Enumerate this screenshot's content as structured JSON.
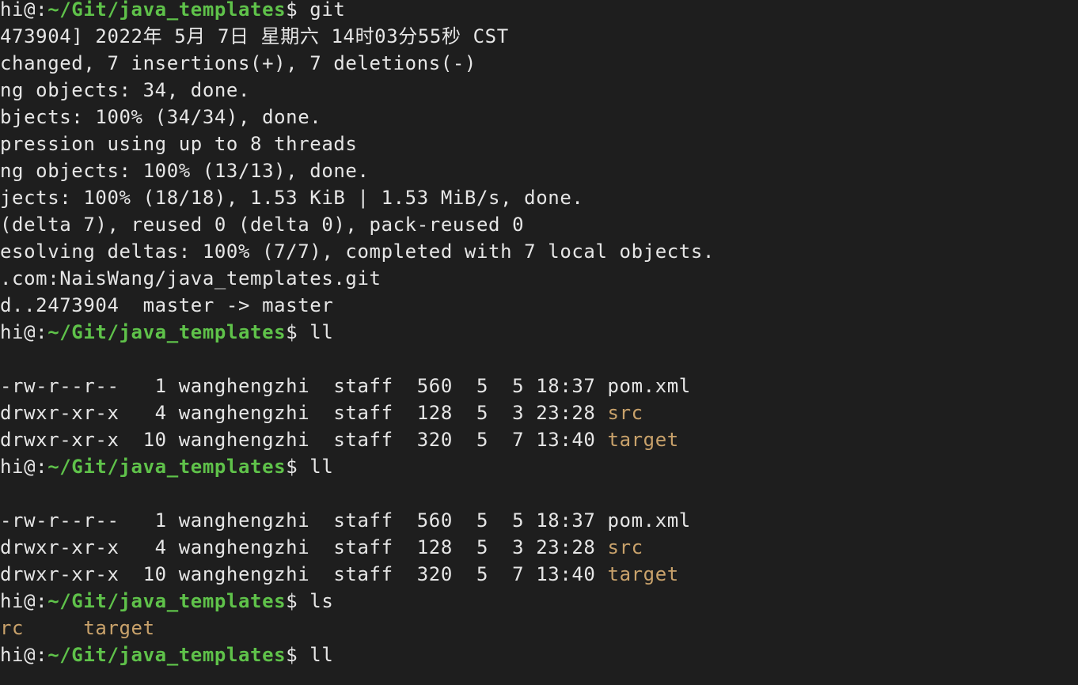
{
  "colors": {
    "background": "#1e1e1e",
    "text": "#e6e6e6",
    "prompt_path": "#5fc24a",
    "directory": "#c9a26b"
  },
  "lines": [
    {
      "parts": [
        {
          "text": "hi@:",
          "style": "plain"
        },
        {
          "text": "~/Git/java_templates",
          "style": "path"
        },
        {
          "text": "$ git",
          "style": "plain"
        }
      ]
    },
    {
      "parts": [
        {
          "text": "473904] 2022年 5月 7日 星期六 14时03分55秒 CST",
          "style": "plain"
        }
      ]
    },
    {
      "parts": [
        {
          "text": "changed, 7 insertions(+), 7 deletions(-)",
          "style": "plain"
        }
      ]
    },
    {
      "parts": [
        {
          "text": "ng objects: 34, done.",
          "style": "plain"
        }
      ]
    },
    {
      "parts": [
        {
          "text": "bjects: 100% (34/34), done.",
          "style": "plain"
        }
      ]
    },
    {
      "parts": [
        {
          "text": "pression using up to 8 threads",
          "style": "plain"
        }
      ]
    },
    {
      "parts": [
        {
          "text": "ng objects: 100% (13/13), done.",
          "style": "plain"
        }
      ]
    },
    {
      "parts": [
        {
          "text": "jects: 100% (18/18), 1.53 KiB | 1.53 MiB/s, done.",
          "style": "plain"
        }
      ]
    },
    {
      "parts": [
        {
          "text": "(delta 7), reused 0 (delta 0), pack-reused 0",
          "style": "plain"
        }
      ]
    },
    {
      "parts": [
        {
          "text": "esolving deltas: 100% (7/7), completed with 7 local objects.",
          "style": "plain"
        }
      ]
    },
    {
      "parts": [
        {
          "text": ".com:NaisWang/java_templates.git",
          "style": "plain"
        }
      ]
    },
    {
      "parts": [
        {
          "text": "d..2473904  master -> master",
          "style": "plain"
        }
      ]
    },
    {
      "parts": [
        {
          "text": "hi@:",
          "style": "plain"
        },
        {
          "text": "~/Git/java_templates",
          "style": "path"
        },
        {
          "text": "$ ll",
          "style": "plain"
        }
      ]
    },
    {
      "parts": []
    },
    {
      "parts": [
        {
          "text": "-rw-r--r--   1 wanghengzhi  staff  560  5  5 18:37 pom.xml",
          "style": "plain"
        }
      ]
    },
    {
      "parts": [
        {
          "text": "drwxr-xr-x   4 wanghengzhi  staff  128  5  3 23:28 ",
          "style": "plain"
        },
        {
          "text": "src",
          "style": "dir"
        }
      ]
    },
    {
      "parts": [
        {
          "text": "drwxr-xr-x  10 wanghengzhi  staff  320  5  7 13:40 ",
          "style": "plain"
        },
        {
          "text": "target",
          "style": "dir"
        }
      ]
    },
    {
      "parts": [
        {
          "text": "hi@:",
          "style": "plain"
        },
        {
          "text": "~/Git/java_templates",
          "style": "path"
        },
        {
          "text": "$ ll",
          "style": "plain"
        }
      ]
    },
    {
      "parts": []
    },
    {
      "parts": [
        {
          "text": "-rw-r--r--   1 wanghengzhi  staff  560  5  5 18:37 pom.xml",
          "style": "plain"
        }
      ]
    },
    {
      "parts": [
        {
          "text": "drwxr-xr-x   4 wanghengzhi  staff  128  5  3 23:28 ",
          "style": "plain"
        },
        {
          "text": "src",
          "style": "dir"
        }
      ]
    },
    {
      "parts": [
        {
          "text": "drwxr-xr-x  10 wanghengzhi  staff  320  5  7 13:40 ",
          "style": "plain"
        },
        {
          "text": "target",
          "style": "dir"
        }
      ]
    },
    {
      "parts": [
        {
          "text": "hi@:",
          "style": "plain"
        },
        {
          "text": "~/Git/java_templates",
          "style": "path"
        },
        {
          "text": "$ ls",
          "style": "plain"
        }
      ]
    },
    {
      "parts": [
        {
          "text": "rc",
          "style": "dir"
        },
        {
          "text": "     ",
          "style": "plain"
        },
        {
          "text": "target",
          "style": "dir"
        }
      ]
    },
    {
      "parts": [
        {
          "text": "hi@:",
          "style": "plain"
        },
        {
          "text": "~/Git/java_templates",
          "style": "path"
        },
        {
          "text": "$ ll",
          "style": "plain"
        }
      ]
    }
  ]
}
